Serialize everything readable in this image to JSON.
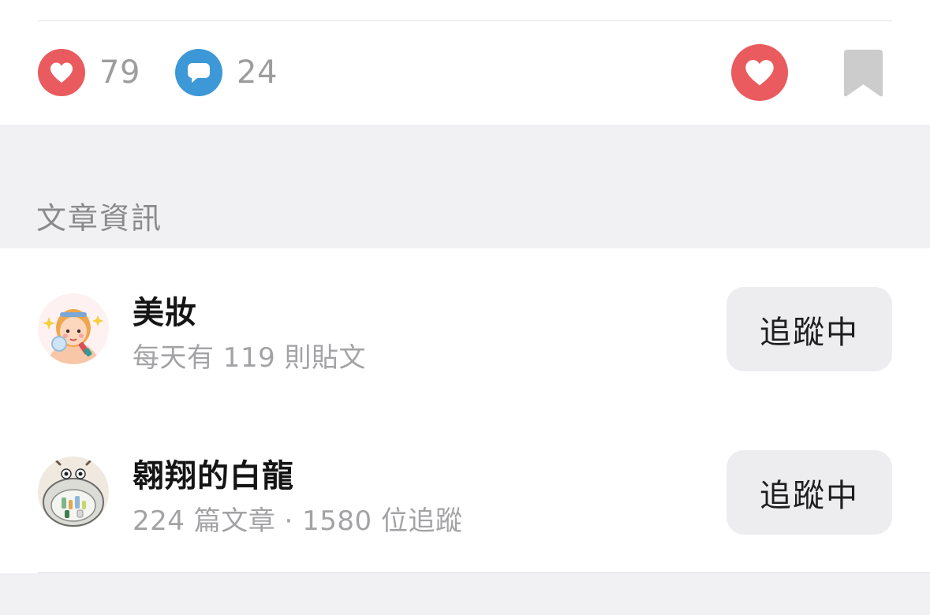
{
  "actions": {
    "likes": {
      "icon": "heart-icon",
      "count": "79",
      "color": "#e95b5e"
    },
    "comments": {
      "icon": "comment-bubble-icon",
      "count": "24",
      "color": "#3c98d6"
    },
    "like_button": {
      "icon": "heart-icon",
      "color": "#e95b5e"
    },
    "save_button": {
      "icon": "bookmark-icon",
      "color": "#cccccc"
    }
  },
  "section": {
    "title": "文章資訊"
  },
  "rows": [
    {
      "title": "美妝",
      "subtitle": "每天有 119 則貼文",
      "button_label": "追蹤中",
      "avatar": "makeup-girl-avatar"
    },
    {
      "title": "翱翔的白龍",
      "subtitle": "224 篇文章 · 1580 位追蹤",
      "button_label": "追蹤中",
      "avatar": "white-dragon-avatar"
    }
  ]
}
